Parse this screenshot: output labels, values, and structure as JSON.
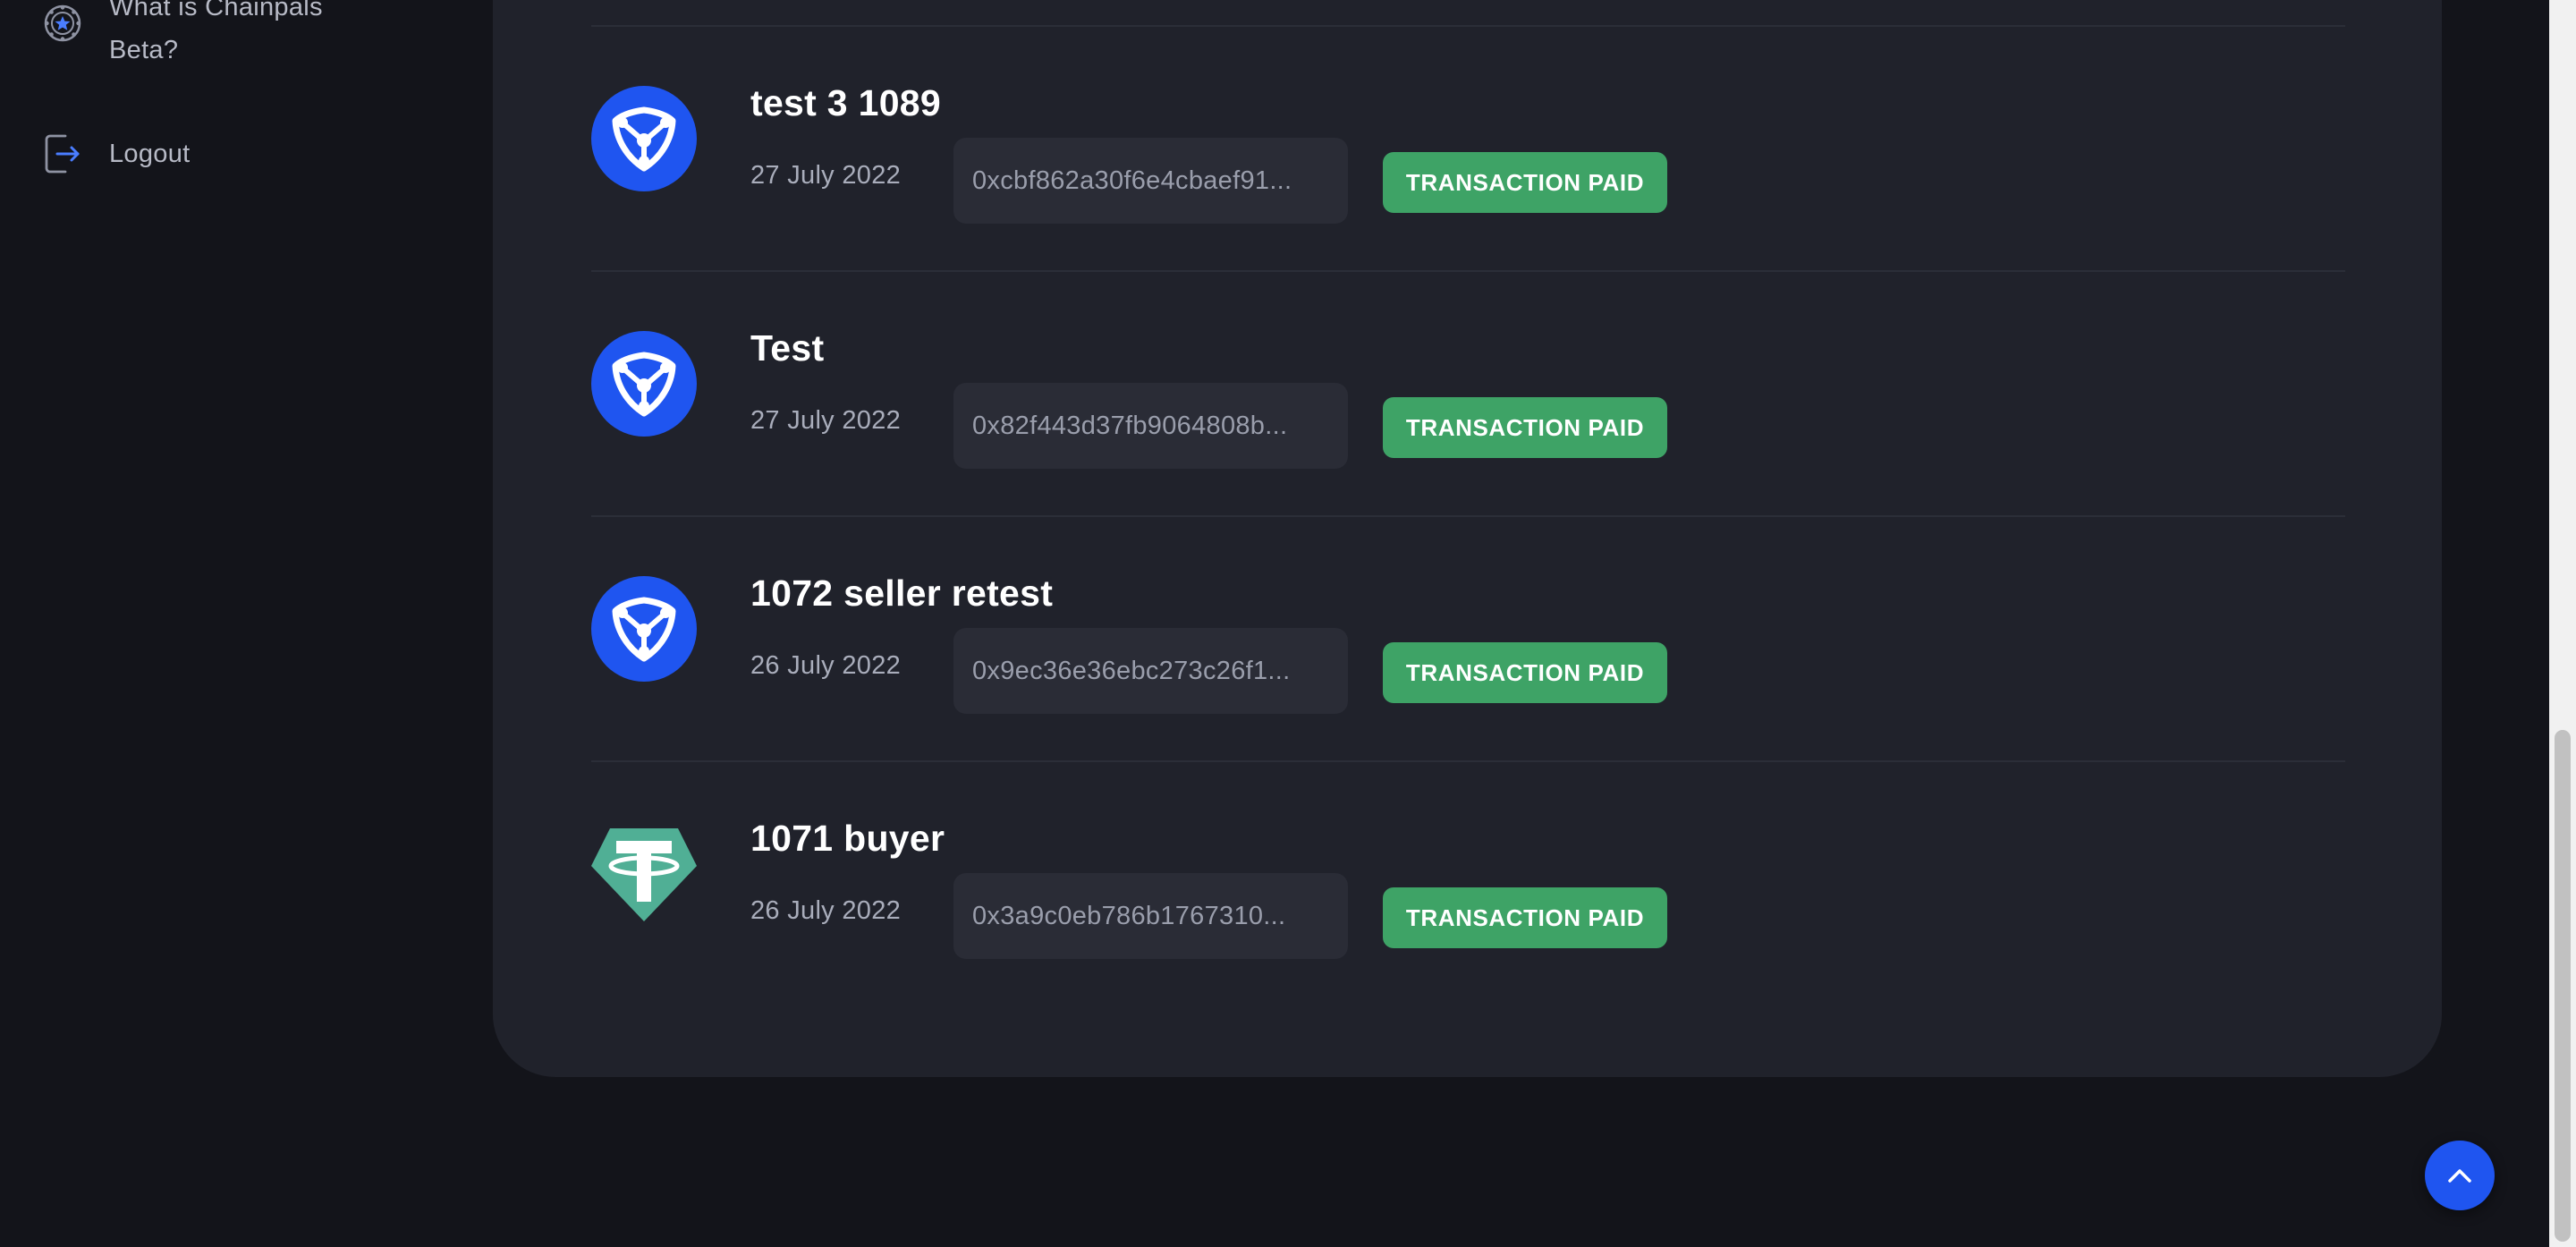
{
  "sidebar": {
    "items": [
      {
        "label": "What is Chainpals Beta?",
        "icon": "chainpals-star-icon"
      },
      {
        "label": "Logout",
        "icon": "logout-icon"
      }
    ]
  },
  "transactions": [
    {
      "title": "test 3 1089",
      "date": "27 July 2022",
      "hash": "0xcbf862a30f6e4cbaef91...",
      "status": "TRANSACTION PAID",
      "token_icon": "chainpals-token-icon"
    },
    {
      "title": "Test",
      "date": "27 July 2022",
      "hash": "0x82f443d37fb9064808b...",
      "status": "TRANSACTION PAID",
      "token_icon": "chainpals-token-icon"
    },
    {
      "title": "1072 seller retest",
      "date": "26 July 2022",
      "hash": "0x9ec36e36ebc273c26f1...",
      "status": "TRANSACTION PAID",
      "token_icon": "chainpals-token-icon"
    },
    {
      "title": "1071 buyer",
      "date": "26 July 2022",
      "hash": "0x3a9c0eb786b1767310...",
      "status": "TRANSACTION PAID",
      "token_icon": "tether-usdt-icon"
    }
  ],
  "colors": {
    "background": "#13141a",
    "card": "#20222b",
    "status_paid": "#3ea366",
    "accent_blue": "#1f55f0",
    "tether_green": "#50af95"
  },
  "scroll_top": {
    "icon": "chevron-up-icon"
  }
}
